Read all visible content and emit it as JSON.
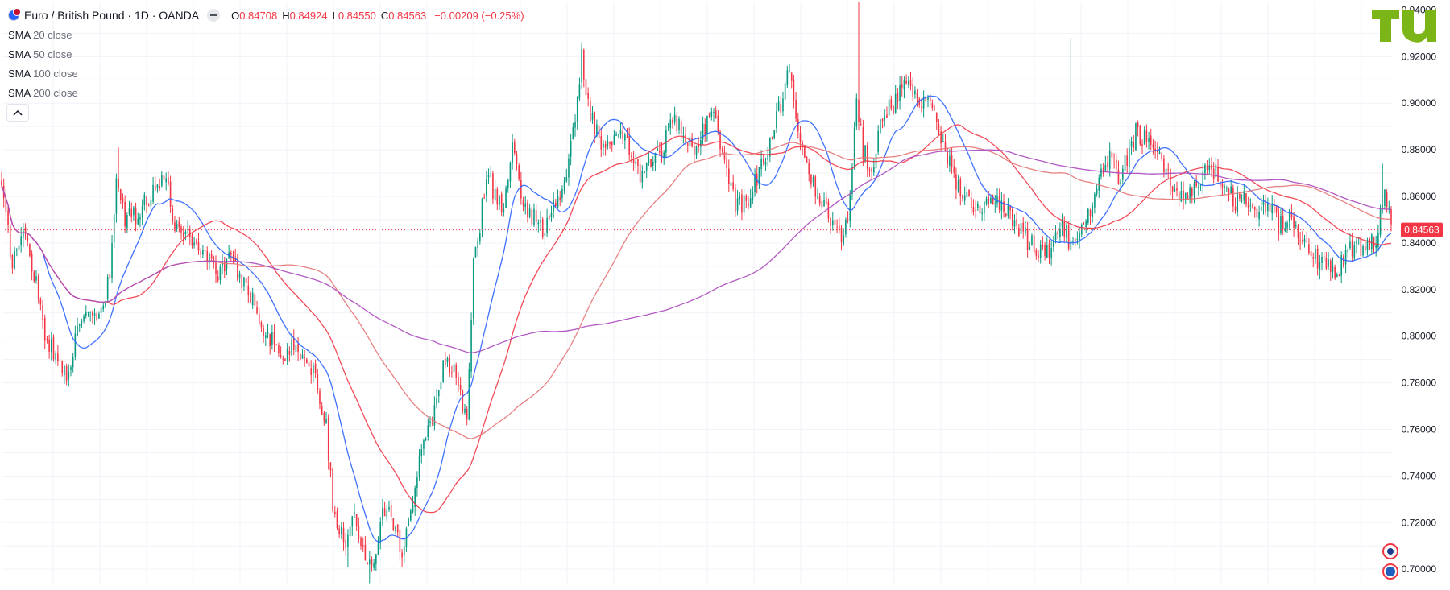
{
  "header": {
    "symbol_title": "Euro / British Pound · 1D · OANDA",
    "ohlc": [
      {
        "label": "O",
        "value": "0.84708"
      },
      {
        "label": "H",
        "value": "0.84924"
      },
      {
        "label": "L",
        "value": "0.84550"
      },
      {
        "label": "C",
        "value": "0.84563"
      }
    ],
    "change": "−0.00209 (−0.25%)"
  },
  "legend": [
    {
      "name": "SMA",
      "params": "20 close",
      "color": "#2962ff"
    },
    {
      "name": "SMA",
      "params": "50 close",
      "color": "#f23645"
    },
    {
      "name": "SMA",
      "params": "100 close",
      "color": "#e57373"
    },
    {
      "name": "SMA",
      "params": "200 close",
      "color": "#ab47bc"
    }
  ],
  "colors": {
    "up": "#089981",
    "down": "#f23645",
    "grid": "#f0f3fa",
    "axis_text": "#131722",
    "price_line": "#f23645",
    "logo": "#7cb518"
  },
  "icons": {
    "symbol": "euro-gbp-flags-icon",
    "collapse": "chevron-up-icon",
    "logo": "tradingview-logo"
  },
  "chart_data": {
    "type": "candlestick",
    "title": "",
    "xlabel": "",
    "ylabel": "",
    "ylim": [
      0.6935,
      0.9436
    ],
    "y_ticks": [
      "0.70000",
      "0.72000",
      "0.74000",
      "0.76000",
      "0.78000",
      "0.80000",
      "0.82000",
      "0.84000",
      "0.86000",
      "0.88000",
      "0.90000",
      "0.92000",
      "0.94000"
    ],
    "grid": true,
    "last_price": "0.84563",
    "anchors": [
      [
        0,
        0.863
      ],
      [
        2,
        0.85
      ],
      [
        5,
        0.832
      ],
      [
        10,
        0.845
      ],
      [
        15,
        0.828
      ],
      [
        20,
        0.802
      ],
      [
        25,
        0.79
      ],
      [
        30,
        0.785
      ],
      [
        35,
        0.8
      ],
      [
        40,
        0.812
      ],
      [
        45,
        0.806
      ],
      [
        50,
        0.825
      ],
      [
        53,
        0.868
      ],
      [
        57,
        0.85
      ],
      [
        62,
        0.852
      ],
      [
        66,
        0.858
      ],
      [
        70,
        0.862
      ],
      [
        75,
        0.87
      ],
      [
        80,
        0.848
      ],
      [
        85,
        0.845
      ],
      [
        90,
        0.84
      ],
      [
        95,
        0.834
      ],
      [
        100,
        0.828
      ],
      [
        105,
        0.833
      ],
      [
        110,
        0.826
      ],
      [
        115,
        0.818
      ],
      [
        120,
        0.806
      ],
      [
        125,
        0.798
      ],
      [
        130,
        0.792
      ],
      [
        135,
        0.795
      ],
      [
        140,
        0.792
      ],
      [
        145,
        0.782
      ],
      [
        150,
        0.762
      ],
      [
        153,
        0.728
      ],
      [
        158,
        0.71
      ],
      [
        162,
        0.724
      ],
      [
        167,
        0.708
      ],
      [
        172,
        0.703
      ],
      [
        176,
        0.728
      ],
      [
        180,
        0.725
      ],
      [
        185,
        0.706
      ],
      [
        190,
        0.73
      ],
      [
        195,
        0.755
      ],
      [
        200,
        0.77
      ],
      [
        205,
        0.79
      ],
      [
        210,
        0.785
      ],
      [
        215,
        0.762
      ],
      [
        218,
        0.83
      ],
      [
        222,
        0.855
      ],
      [
        225,
        0.87
      ],
      [
        228,
        0.86
      ],
      [
        232,
        0.856
      ],
      [
        236,
        0.88
      ],
      [
        240,
        0.86
      ],
      [
        245,
        0.852
      ],
      [
        250,
        0.846
      ],
      [
        255,
        0.855
      ],
      [
        260,
        0.868
      ],
      [
        265,
        0.89
      ],
      [
        268,
        0.92
      ],
      [
        272,
        0.895
      ],
      [
        278,
        0.88
      ],
      [
        283,
        0.882
      ],
      [
        288,
        0.888
      ],
      [
        292,
        0.875
      ],
      [
        296,
        0.868
      ],
      [
        300,
        0.875
      ],
      [
        305,
        0.88
      ],
      [
        310,
        0.893
      ],
      [
        315,
        0.886
      ],
      [
        320,
        0.878
      ],
      [
        325,
        0.89
      ],
      [
        328,
        0.9
      ],
      [
        332,
        0.882
      ],
      [
        336,
        0.866
      ],
      [
        340,
        0.855
      ],
      [
        345,
        0.86
      ],
      [
        350,
        0.87
      ],
      [
        355,
        0.885
      ],
      [
        360,
        0.9
      ],
      [
        363,
        0.915
      ],
      [
        367,
        0.895
      ],
      [
        371,
        0.88
      ],
      [
        375,
        0.864
      ],
      [
        380,
        0.855
      ],
      [
        385,
        0.845
      ],
      [
        389,
        0.842
      ],
      [
        392,
        0.858
      ],
      [
        395,
        0.904
      ],
      [
        398,
        0.88
      ],
      [
        402,
        0.872
      ],
      [
        407,
        0.895
      ],
      [
        412,
        0.9
      ],
      [
        417,
        0.912
      ],
      [
        421,
        0.905
      ],
      [
        426,
        0.9
      ],
      [
        431,
        0.896
      ],
      [
        436,
        0.878
      ],
      [
        441,
        0.866
      ],
      [
        446,
        0.86
      ],
      [
        451,
        0.856
      ],
      [
        456,
        0.855
      ],
      [
        461,
        0.857
      ],
      [
        466,
        0.852
      ],
      [
        470,
        0.846
      ],
      [
        475,
        0.84
      ],
      [
        480,
        0.836
      ],
      [
        485,
        0.838
      ],
      [
        490,
        0.848
      ],
      [
        495,
        0.838
      ],
      [
        500,
        0.845
      ],
      [
        504,
        0.858
      ],
      [
        508,
        0.868
      ],
      [
        512,
        0.876
      ],
      [
        516,
        0.868
      ],
      [
        520,
        0.876
      ],
      [
        524,
        0.888
      ],
      [
        528,
        0.885
      ],
      [
        533,
        0.878
      ],
      [
        538,
        0.87
      ],
      [
        542,
        0.862
      ],
      [
        547,
        0.86
      ],
      [
        552,
        0.866
      ],
      [
        557,
        0.872
      ],
      [
        561,
        0.87
      ],
      [
        566,
        0.862
      ],
      [
        570,
        0.858
      ],
      [
        575,
        0.858
      ],
      [
        580,
        0.854
      ],
      [
        585,
        0.858
      ],
      [
        590,
        0.848
      ],
      [
        595,
        0.852
      ],
      [
        600,
        0.843
      ],
      [
        605,
        0.838
      ],
      [
        610,
        0.83
      ],
      [
        615,
        0.828
      ],
      [
        620,
        0.832
      ],
      [
        625,
        0.84
      ],
      [
        630,
        0.838
      ],
      [
        635,
        0.842
      ],
      [
        639,
        0.865
      ],
      [
        642,
        0.848
      ]
    ],
    "spikes": [
      {
        "i": 396,
        "high": 0.9436
      },
      {
        "i": 494,
        "high": 0.928
      },
      {
        "i": 638,
        "high": 0.874
      },
      {
        "i": 54,
        "high": 0.881
      },
      {
        "i": 160,
        "low": 0.701
      },
      {
        "i": 170,
        "low": 0.694
      }
    ],
    "sma_periods": [
      20,
      50,
      100,
      200
    ],
    "seed": 20240517
  }
}
